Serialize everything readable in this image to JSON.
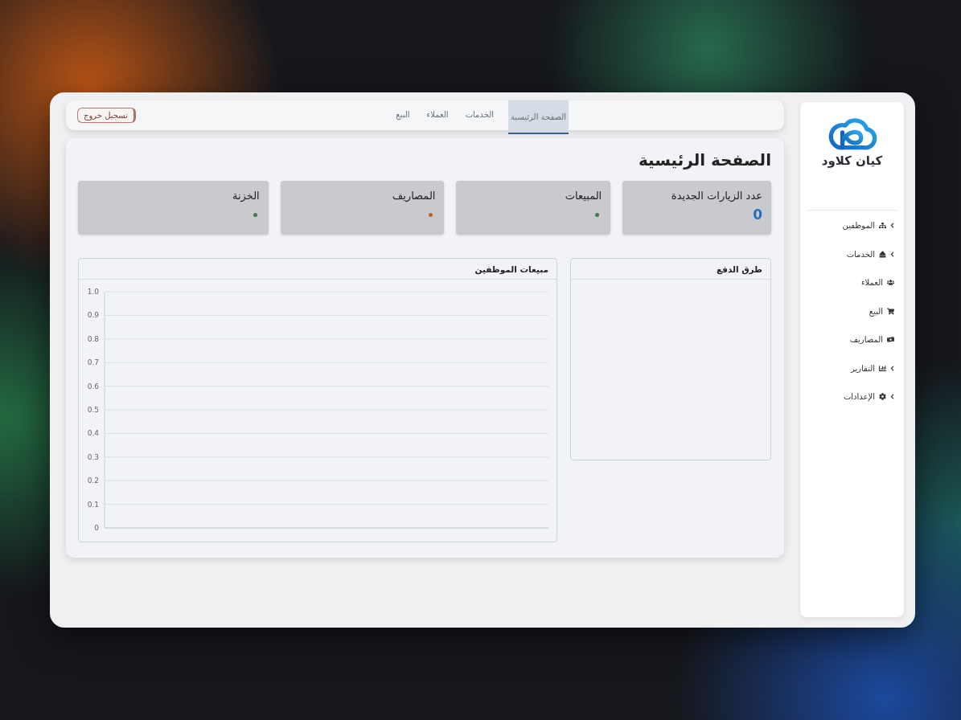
{
  "sidebar": {
    "brand": "كيان كلاود",
    "items": [
      {
        "label": "الموظفين",
        "kind": "group"
      },
      {
        "label": "الخدمات",
        "kind": "group"
      },
      {
        "label": "العملاء",
        "kind": "link"
      },
      {
        "label": "البيع",
        "kind": "link"
      },
      {
        "label": "المصاريف",
        "kind": "link"
      },
      {
        "label": "التقارير",
        "kind": "group"
      },
      {
        "label": "الإعدادات",
        "kind": "group"
      }
    ]
  },
  "top_bar": {
    "tabs": [
      {
        "label": "الصفحة الرئيسية",
        "selected": true
      },
      {
        "label": "الخدمات",
        "selected": false
      },
      {
        "label": "العملاء",
        "selected": false
      },
      {
        "label": "البيع",
        "selected": false
      }
    ],
    "logout_button": "تسجيل خروج"
  },
  "page_title": "الصفحة الرئيسية",
  "stat_cards": [
    {
      "title": "عدد الزيارات الجديدة",
      "kind": "value",
      "value": "0"
    },
    {
      "title": "المبيعات",
      "kind": "dot",
      "color": "#3a7d55"
    },
    {
      "title": "المصاريف",
      "kind": "dot",
      "color": "#c2602e"
    },
    {
      "title": "الخزنة",
      "kind": "dot",
      "color": "#3a7d55"
    }
  ],
  "payment_methods_panel": {
    "title": "طرق الدفع"
  },
  "employee_sales_panel": {
    "title": "مبيعات الموظفين",
    "chart_data": {
      "type": "line",
      "grid": true,
      "categories": [
        null
      ],
      "ylim": [
        0,
        1
      ],
      "yticks": [
        {
          "value": 0,
          "label": "0"
        },
        {
          "value": 0.1,
          "label": "0.1"
        },
        {
          "value": 0.2,
          "label": "0.2"
        },
        {
          "value": 0.3,
          "label": "0.3"
        },
        {
          "value": 0.4,
          "label": "0.4"
        },
        {
          "value": 0.5,
          "label": "0.5"
        },
        {
          "value": 0.6,
          "label": "0.6"
        },
        {
          "value": 0.7,
          "label": "0.7"
        },
        {
          "value": 0.8,
          "label": "0.8"
        },
        {
          "value": 0.9,
          "label": "0.9"
        },
        {
          "value": 1,
          "label": "1.0"
        }
      ]
    }
  }
}
